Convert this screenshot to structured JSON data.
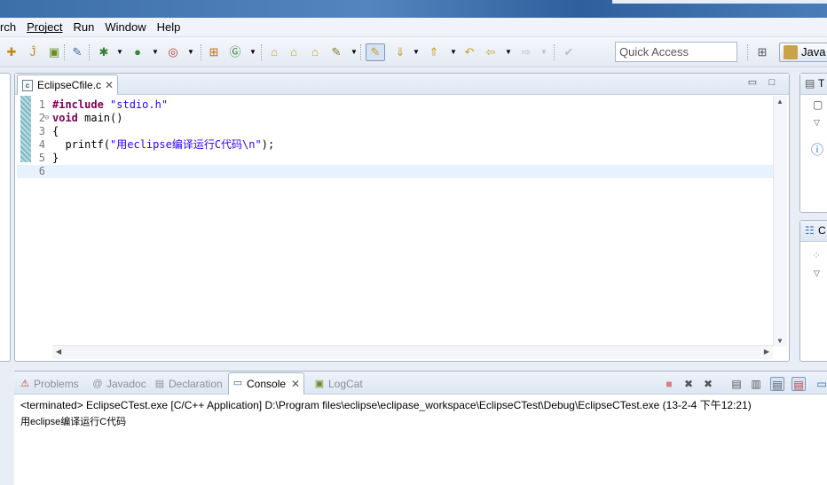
{
  "menubar": {
    "items": [
      {
        "label": "rch",
        "mnemonic": ""
      },
      {
        "label": "Project",
        "mnemonic": "P"
      },
      {
        "label": "Run",
        "mnemonic": "R"
      },
      {
        "label": "Window",
        "mnemonic": "W"
      },
      {
        "label": "Help",
        "mnemonic": "H"
      }
    ]
  },
  "toolbar": {
    "quick_access_placeholder": "Quick Access",
    "perspective_label": "Java"
  },
  "editor": {
    "tab_label": "EclipseCfile.c",
    "lines": [
      {
        "n": "1",
        "parts": [
          {
            "t": "#include ",
            "c": "kw"
          },
          {
            "t": "\"stdio.h\"",
            "c": "str"
          }
        ]
      },
      {
        "n": "2",
        "parts": [
          {
            "t": "void",
            "c": "kw"
          },
          {
            "t": " main()",
            "c": ""
          }
        ]
      },
      {
        "n": "3",
        "parts": [
          {
            "t": "{",
            "c": ""
          }
        ]
      },
      {
        "n": "4",
        "parts": [
          {
            "t": "  printf(",
            "c": ""
          },
          {
            "t": "\"用eclipse编译运行C代码\\n\"",
            "c": "str"
          },
          {
            "t": ");",
            "c": ""
          }
        ]
      },
      {
        "n": "5",
        "parts": [
          {
            "t": "}",
            "c": ""
          }
        ]
      },
      {
        "n": "6",
        "parts": [
          {
            "t": "",
            "c": ""
          }
        ]
      }
    ]
  },
  "right_panels": {
    "top_tab": "T",
    "bottom_tab": "C"
  },
  "console": {
    "tabs": [
      {
        "label": "Problems",
        "icon": "problems-icon",
        "active": false
      },
      {
        "label": "Javadoc",
        "icon": "javadoc-icon",
        "active": false
      },
      {
        "label": "Declaration",
        "icon": "declaration-icon",
        "active": false
      },
      {
        "label": "Console",
        "icon": "console-icon",
        "active": true
      },
      {
        "label": "LogCat",
        "icon": "logcat-icon",
        "active": false
      }
    ],
    "header": "<terminated> EclipseCTest.exe [C/C++ Application] D:\\Program files\\eclipse\\eclipase_workspace\\EclipseCTest\\Debug\\EclipseCTest.exe (13-2-4 下午12:21)",
    "output": "用eclipse编译运行C代码"
  }
}
